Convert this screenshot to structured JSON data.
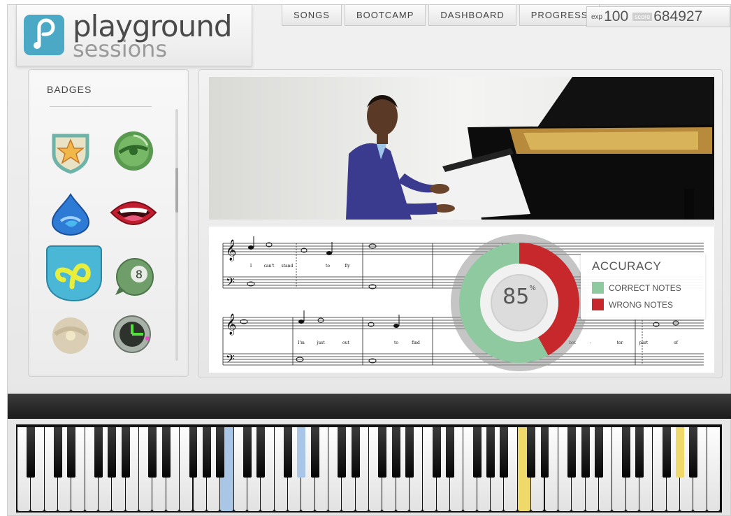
{
  "brand": {
    "name_line1": "playground",
    "name_line2": "sessions"
  },
  "nav": {
    "items": [
      {
        "label": "SONGS"
      },
      {
        "label": "BOOTCAMP"
      },
      {
        "label": "DASHBOARD"
      },
      {
        "label": "PROGRESS"
      }
    ]
  },
  "stats": {
    "exp_label": "exp",
    "exp_value": "100",
    "score_label": "score",
    "score_value": "684927"
  },
  "badges": {
    "title": "BADGES",
    "items": [
      {
        "icon": "star-shield-badge-icon"
      },
      {
        "icon": "record-swirl-badge-icon"
      },
      {
        "icon": "water-drop-badge-icon"
      },
      {
        "icon": "singing-mouth-badge-icon"
      },
      {
        "icon": "playground-logo-badge-icon"
      },
      {
        "icon": "eight-ball-badge-icon"
      },
      {
        "icon": "faded-record-badge-icon"
      },
      {
        "icon": "metronome-clock-badge-icon"
      }
    ]
  },
  "accuracy": {
    "title": "ACCURACY",
    "value": "85",
    "unit": "%",
    "correct_label": "CORRECT NOTES",
    "wrong_label": "WRONG NOTES",
    "correct_fraction": 0.58,
    "wrong_fraction": 0.42,
    "correct_color": "#8fc9a0",
    "wrong_color": "#c6282b"
  },
  "sheet_music": {
    "lyrics_line1": [
      "I",
      "can't",
      "stand",
      "to",
      "fly"
    ],
    "lyrics_line2": [
      "I'm",
      "just",
      "out",
      "to",
      "find"
    ],
    "lyrics_line3": [
      "bet",
      "-",
      "ter",
      "part",
      "of"
    ]
  },
  "keyboard": {
    "white_key_count": 52,
    "highlight_blue": "#a9c6e6",
    "highlight_yellow": "#efd96a"
  }
}
